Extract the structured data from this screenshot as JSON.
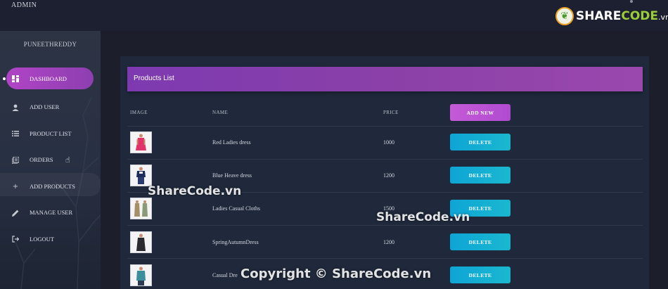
{
  "app": {
    "title": "ADMIN"
  },
  "logo": {
    "prefix": "SHARE",
    "suffix": "CODE",
    "domain": ".vn",
    "icon": "leaf-icon"
  },
  "sidebar": {
    "username": "PUNEETHREDDY",
    "items": [
      {
        "label": "DASHBOARD",
        "icon": "dashboard-icon",
        "active": true
      },
      {
        "label": "ADD USER",
        "icon": "user-icon"
      },
      {
        "label": "PRODUCT LIST",
        "icon": "list-icon"
      },
      {
        "label": "ORDERS",
        "icon": "orders-icon"
      },
      {
        "label": "ADD PRODUCTS",
        "icon": "plus-icon"
      },
      {
        "label": "MANAGE USER",
        "icon": "pencil-icon"
      },
      {
        "label": "LOGOUT",
        "icon": "logout-icon"
      }
    ]
  },
  "products": {
    "title": "Products List",
    "columns": {
      "image": "IMAGE",
      "name": "NAME",
      "price": "PRICE"
    },
    "add_label": "ADD NEW",
    "delete_label": "DELETE",
    "rows": [
      {
        "name": "Red Ladies dress",
        "price": "1000"
      },
      {
        "name": "Blue Heave dress",
        "price": "1200"
      },
      {
        "name": "Ladies Casual Cloths",
        "price": "1500"
      },
      {
        "name": "SpringAutumnDress",
        "price": "1200"
      },
      {
        "name": "Casual Dre",
        "price": ""
      }
    ]
  },
  "watermarks": {
    "w1": "ShareCode.vn",
    "w2": "ShareCode.vn",
    "w3": "Copyright © ShareCode.vn"
  },
  "colors": {
    "accent": "#9a45b4",
    "add_button": "#c45ad6",
    "delete_button": "#17acd3",
    "panel": "#1f293b"
  }
}
